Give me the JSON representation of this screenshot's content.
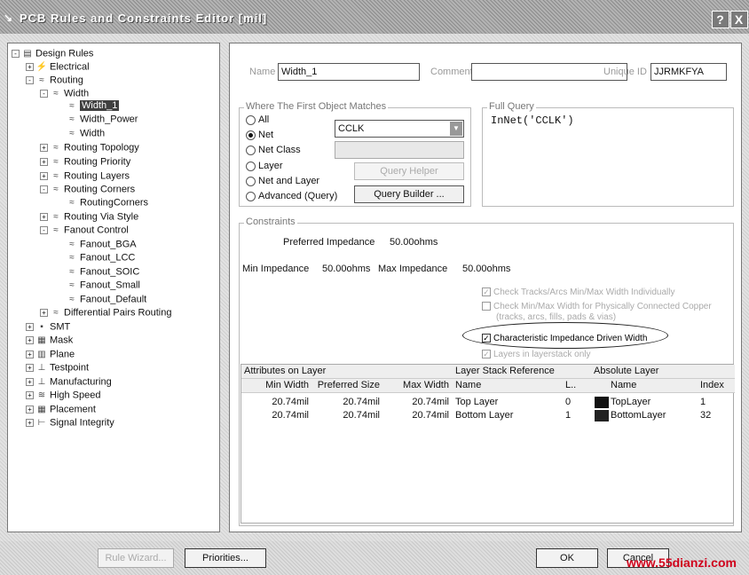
{
  "window": {
    "title": "PCB Rules and Constraints Editor [mil]",
    "help_label": "?",
    "close_label": "X"
  },
  "tree": {
    "items": [
      {
        "label": "Design Rules",
        "expander": "-",
        "icon": "rules-folder-icon",
        "glyph": "▤"
      },
      {
        "label": "Electrical",
        "expander": "+",
        "icon": "electrical-icon",
        "glyph": "⚡"
      },
      {
        "label": "Routing",
        "expander": "-",
        "icon": "routing-icon",
        "glyph": "≈"
      },
      {
        "label": "Width",
        "expander": "-",
        "icon": "width-rule-icon",
        "glyph": "≈"
      },
      {
        "label": "Width_1",
        "expander": "",
        "icon": "width-rule-icon",
        "glyph": "≈",
        "selected": true
      },
      {
        "label": "Width_Power",
        "expander": "",
        "icon": "width-rule-icon",
        "glyph": "≈"
      },
      {
        "label": "Width",
        "expander": "",
        "icon": "width-rule-icon",
        "glyph": "≈"
      },
      {
        "label": "Routing Topology",
        "expander": "+",
        "icon": "routing-topology-icon",
        "glyph": "≈"
      },
      {
        "label": "Routing Priority",
        "expander": "+",
        "icon": "routing-priority-icon",
        "glyph": "≈"
      },
      {
        "label": "Routing Layers",
        "expander": "+",
        "icon": "routing-layers-icon",
        "glyph": "≈"
      },
      {
        "label": "Routing Corners",
        "expander": "-",
        "icon": "routing-corners-icon",
        "glyph": "≈"
      },
      {
        "label": "RoutingCorners",
        "expander": "",
        "icon": "routing-corners-icon",
        "glyph": "≈"
      },
      {
        "label": "Routing Via Style",
        "expander": "+",
        "icon": "routing-via-icon",
        "glyph": "≈"
      },
      {
        "label": "Fanout Control",
        "expander": "-",
        "icon": "fanout-icon",
        "glyph": "≈"
      },
      {
        "label": "Fanout_BGA",
        "expander": "",
        "icon": "fanout-icon",
        "glyph": "≈"
      },
      {
        "label": "Fanout_LCC",
        "expander": "",
        "icon": "fanout-icon",
        "glyph": "≈"
      },
      {
        "label": "Fanout_SOIC",
        "expander": "",
        "icon": "fanout-icon",
        "glyph": "≈"
      },
      {
        "label": "Fanout_Small",
        "expander": "",
        "icon": "fanout-icon",
        "glyph": "≈"
      },
      {
        "label": "Fanout_Default",
        "expander": "",
        "icon": "fanout-icon",
        "glyph": "≈"
      },
      {
        "label": "Differential Pairs Routing",
        "expander": "+",
        "icon": "diff-pairs-icon",
        "glyph": "≈"
      },
      {
        "label": "SMT",
        "expander": "+",
        "icon": "smt-icon",
        "glyph": "▪"
      },
      {
        "label": "Mask",
        "expander": "+",
        "icon": "mask-icon",
        "glyph": "▦"
      },
      {
        "label": "Plane",
        "expander": "+",
        "icon": "plane-icon",
        "glyph": "▥"
      },
      {
        "label": "Testpoint",
        "expander": "+",
        "icon": "testpoint-icon",
        "glyph": "⊥"
      },
      {
        "label": "Manufacturing",
        "expander": "+",
        "icon": "manufacturing-icon",
        "glyph": "⊥"
      },
      {
        "label": "High Speed",
        "expander": "+",
        "icon": "high-speed-icon",
        "glyph": "≋"
      },
      {
        "label": "Placement",
        "expander": "+",
        "icon": "placement-icon",
        "glyph": "▦"
      },
      {
        "label": "Signal Integrity",
        "expander": "+",
        "icon": "signal-integrity-icon",
        "glyph": "⊢"
      }
    ]
  },
  "header": {
    "name_label": "Name",
    "name_value": "Width_1",
    "comment_label": "Comment",
    "comment_value": "",
    "uniqueid_label": "Unique ID",
    "uniqueid_value": "JJRMKFYA"
  },
  "match": {
    "title": "Where The First Object Matches",
    "options": [
      {
        "label": "All",
        "selected": false
      },
      {
        "label": "Net",
        "selected": true
      },
      {
        "label": "Net Class",
        "selected": false
      },
      {
        "label": "Layer",
        "selected": false
      },
      {
        "label": "Net and Layer",
        "selected": false
      },
      {
        "label": "Advanced (Query)",
        "selected": false
      }
    ],
    "net_value": "CCLK",
    "query_helper_label": "Query Helper",
    "query_builder_label": "Query Builder ..."
  },
  "full_query": {
    "title": "Full Query",
    "text": "InNet('CCLK')"
  },
  "constraints": {
    "title": "Constraints",
    "preferred_label": "Preferred Impedance",
    "preferred_value": "50.00ohms",
    "min_label": "Min Impedance",
    "min_value": "50.00ohms",
    "max_label": "Max Impedance",
    "max_value": "50.00ohms",
    "checks": [
      {
        "label": "Check Tracks/Arcs Min/Max Width Individually",
        "checked": true,
        "enabled": false
      },
      {
        "label": "Check Min/Max Width for Physically Connected Copper",
        "checked": false,
        "enabled": false
      },
      {
        "label": "(tracks, arcs, fills, pads & vias)",
        "checked": false,
        "enabled": false
      },
      {
        "label": "Characteristic Impedance Driven Width",
        "checked": true,
        "enabled": true
      },
      {
        "label": "Layers in layerstack only",
        "checked": true,
        "enabled": false
      }
    ]
  },
  "layers_table": {
    "group_headers": [
      "Attributes on Layer",
      "Layer Stack Reference",
      "Absolute Layer"
    ],
    "columns": [
      "Min Width",
      "Preferred Size",
      "Max Width",
      "Name",
      "L..",
      "Name",
      "Index"
    ],
    "rows": [
      {
        "min": "20.74mil",
        "pref": "20.74mil",
        "max": "20.74mil",
        "name": "Top Layer",
        "l": "0",
        "color": "#111111",
        "abs_name": "TopLayer",
        "index": "1"
      },
      {
        "min": "20.74mil",
        "pref": "20.74mil",
        "max": "20.74mil",
        "name": "Bottom Layer",
        "l": "1",
        "color": "#222222",
        "abs_name": "BottomLayer",
        "index": "32"
      }
    ]
  },
  "footer": {
    "rule_wizard_label": "Rule Wizard...",
    "priorities_label": "Priorities...",
    "ok_label": "OK",
    "cancel_label": "Cancel"
  },
  "watermark": "www.55dianzi.com"
}
